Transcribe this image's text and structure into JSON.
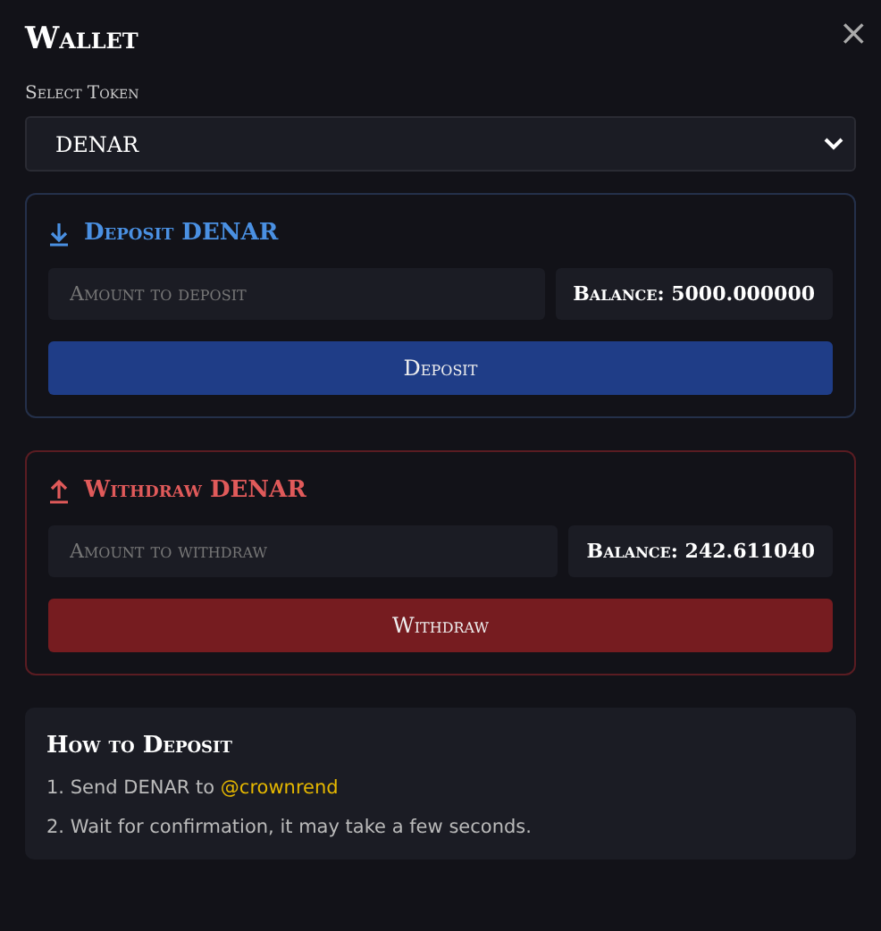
{
  "window": {
    "title": "Wallet",
    "close": "×"
  },
  "token": {
    "label": "Select Token",
    "value": "DENAR"
  },
  "sections": [
    {
      "kind": "deposit",
      "title": "Deposit DENAR",
      "placeholder": "Amount to deposit",
      "balance": "Balance: 5000.000000",
      "button": "Deposit"
    },
    {
      "kind": "withdraw",
      "title": "Withdraw DENAR",
      "placeholder": "Amount to withdraw",
      "balance": "Balance: 242.611040",
      "button": "Withdraw"
    }
  ],
  "help": {
    "title": "How to Deposit",
    "steps": [
      {
        "text": "1. Send DENAR to ",
        "link": "@crownrend"
      },
      {
        "text": "2. Wait for confirmation, it may take a few seconds."
      }
    ]
  }
}
